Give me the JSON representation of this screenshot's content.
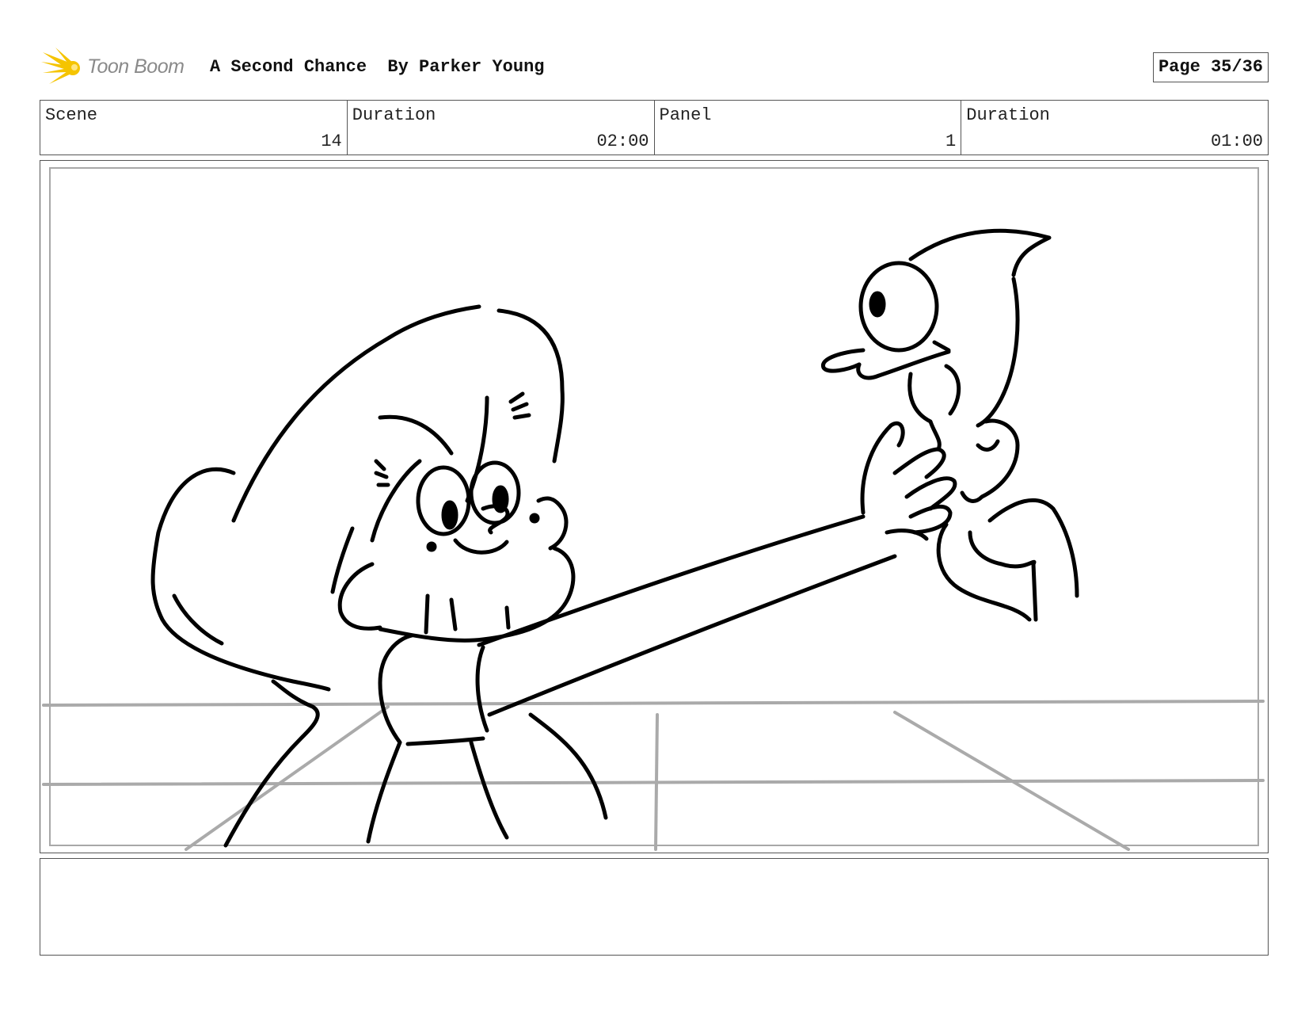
{
  "header": {
    "logo_text": "Toon Boom",
    "project_title": "A Second Chance  By Parker Young",
    "page_label": "Page 35/36"
  },
  "info": {
    "scene_label": "Scene",
    "scene_value": "14",
    "scene_duration_label": "Duration",
    "scene_duration_value": "02:00",
    "panel_label": "Panel",
    "panel_value": "1",
    "panel_duration_label": "Duration",
    "panel_duration_value": "01:00"
  },
  "notes": {
    "text": ""
  },
  "colors": {
    "logo_accent": "#f5c400",
    "ink": "#000000",
    "guide_lines": "#aaaaaa"
  }
}
